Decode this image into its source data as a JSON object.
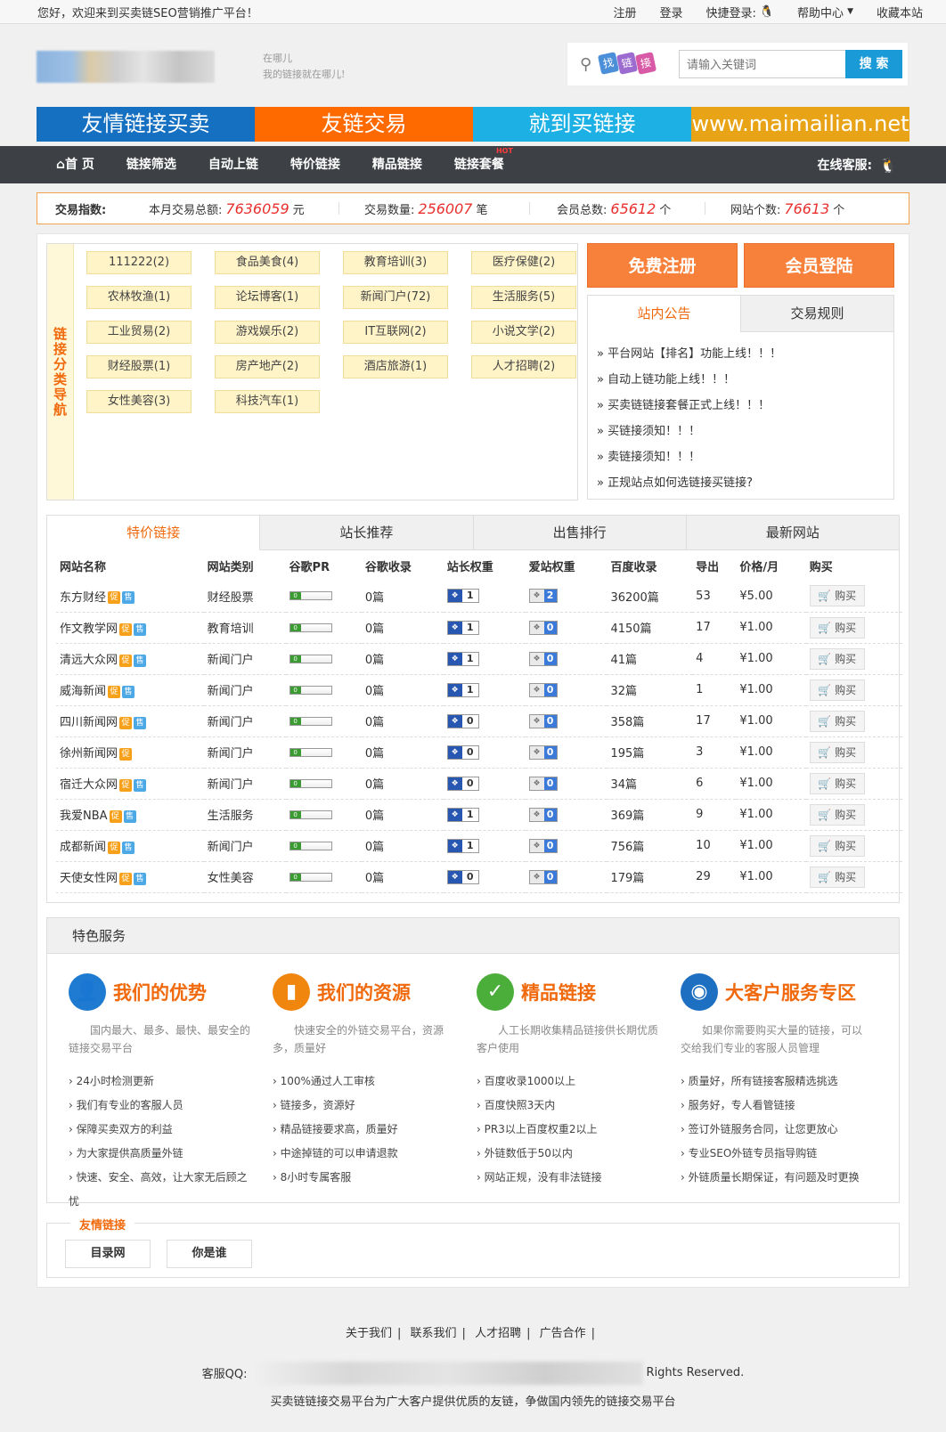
{
  "topbar": {
    "welcome": "您好，欢迎来到买卖链SEO营销推广平台！",
    "register": "注册",
    "login": "登录",
    "quick_login": "快捷登录:",
    "help": "帮助中心",
    "favorite": "收藏本站"
  },
  "header": {
    "slogan_line1": "在哪儿",
    "slogan_line2": "我的链接就在哪儿!",
    "findlink_chars": [
      "找",
      "链",
      "接"
    ],
    "search_placeholder": "请输入关键词",
    "search_button": "搜 索"
  },
  "banner": [
    {
      "text": "友情链接买卖",
      "color": "#1670c2"
    },
    {
      "text": "友链交易",
      "color": "#ff6a00"
    },
    {
      "text": "就到买链接",
      "color": "#1cb0e4"
    },
    {
      "text": "www.maimailian.net",
      "color": "#e8a317"
    }
  ],
  "nav": {
    "items": [
      "首 页",
      "链接筛选",
      "自动上链",
      "特价链接",
      "精品链接",
      "链接套餐"
    ],
    "hot": "HOT",
    "online": "在线客服:"
  },
  "stats": {
    "label": "交易指数:",
    "items": [
      {
        "label": "本月交易总额:",
        "value": "7636059",
        "unit": "元"
      },
      {
        "label": "交易数量:",
        "value": "256007",
        "unit": "笔"
      },
      {
        "label": "会员总数:",
        "value": "65612",
        "unit": "个"
      },
      {
        "label": "网站个数:",
        "value": "76613",
        "unit": "个"
      }
    ]
  },
  "categories": {
    "side_label": "链接分类导航",
    "items": [
      "111222(2)",
      "食品美食(4)",
      "教育培训(3)",
      "医疗保健(2)",
      "农林牧渔(1)",
      "论坛博客(1)",
      "新闻门户(72)",
      "生活服务(5)",
      "工业贸易(2)",
      "游戏娱乐(2)",
      "IT互联网(2)",
      "小说文学(2)",
      "财经股票(1)",
      "房产地产(2)",
      "酒店旅游(1)",
      "人才招聘(2)",
      "女性美容(3)",
      "科技汽车(1)"
    ]
  },
  "actions": {
    "register": "免费注册",
    "login": "会员登陆"
  },
  "notice": {
    "tabs": [
      "站内公告",
      "交易规则"
    ],
    "items": [
      "» 平台网站【排名】功能上线！！！",
      "» 自动上链功能上线！！！",
      "» 买卖链链接套餐正式上线！！！",
      "» 买链接须知！！！",
      "» 卖链接须知！！！",
      "» 正规站点如何选链接买链接?"
    ]
  },
  "listing": {
    "tabs": [
      "特价链接",
      "站长推荐",
      "出售排行",
      "最新网站"
    ],
    "headers": [
      "网站名称",
      "网站类别",
      "谷歌PR",
      "谷歌收录",
      "站长权重",
      "爱站权重",
      "百度收录",
      "导出",
      "价格/月",
      "购买"
    ],
    "pr_label": "0",
    "buy_label": "购买",
    "badge1": "促",
    "badge2": "售",
    "rows": [
      {
        "name": "东方财经",
        "cat": "财经股票",
        "google": "0篇",
        "zz": "1",
        "az": "2",
        "baidu": "36200篇",
        "out": "53",
        "price": "¥5.00",
        "sale": true
      },
      {
        "name": "作文教学网",
        "cat": "教育培训",
        "google": "0篇",
        "zz": "1",
        "az": "0",
        "baidu": "4150篇",
        "out": "17",
        "price": "¥1.00",
        "sale": true
      },
      {
        "name": "清远大众网",
        "cat": "新闻门户",
        "google": "0篇",
        "zz": "1",
        "az": "0",
        "baidu": "41篇",
        "out": "4",
        "price": "¥1.00",
        "sale": true
      },
      {
        "name": "威海新闻",
        "cat": "新闻门户",
        "google": "0篇",
        "zz": "1",
        "az": "0",
        "baidu": "32篇",
        "out": "1",
        "price": "¥1.00",
        "sale": true
      },
      {
        "name": "四川新闻网",
        "cat": "新闻门户",
        "google": "0篇",
        "zz": "0",
        "az": "0",
        "baidu": "358篇",
        "out": "17",
        "price": "¥1.00",
        "sale": true
      },
      {
        "name": "徐州新闻网",
        "cat": "新闻门户",
        "google": "0篇",
        "zz": "0",
        "az": "0",
        "baidu": "195篇",
        "out": "3",
        "price": "¥1.00",
        "sale": false
      },
      {
        "name": "宿迁大众网",
        "cat": "新闻门户",
        "google": "0篇",
        "zz": "0",
        "az": "0",
        "baidu": "34篇",
        "out": "6",
        "price": "¥1.00",
        "sale": true
      },
      {
        "name": "我爱NBA",
        "cat": "生活服务",
        "google": "0篇",
        "zz": "1",
        "az": "0",
        "baidu": "369篇",
        "out": "9",
        "price": "¥1.00",
        "sale": true
      },
      {
        "name": "成都新闻",
        "cat": "新闻门户",
        "google": "0篇",
        "zz": "1",
        "az": "0",
        "baidu": "756篇",
        "out": "10",
        "price": "¥1.00",
        "sale": true
      },
      {
        "name": "天使女性网",
        "cat": "女性美容",
        "google": "0篇",
        "zz": "0",
        "az": "0",
        "baidu": "179篇",
        "out": "29",
        "price": "¥1.00",
        "sale": true
      }
    ]
  },
  "services": {
    "title": "特色服务",
    "cols": [
      {
        "title": "我们的优势",
        "icon": "user-icon",
        "color": "#1f7bd1",
        "desc": "国内最大、最多、最快、最安全的链接交易平台",
        "items": [
          "24小时检测更新",
          "我们有专业的客服人员",
          "保障买卖双方的利益",
          "为大家提供高质量外链",
          "快速、安全、高效，让大家无后顾之忧"
        ]
      },
      {
        "title": "我们的资源",
        "icon": "bar-chart-icon",
        "color": "#f0860e",
        "desc": "快速安全的外链交易平台，资源多，质量好",
        "items": [
          "100%通过人工审核",
          "链接多，资源好",
          "精品链接要求高，质量好",
          "中途掉链的可以申请退款",
          "8小时专属客服"
        ]
      },
      {
        "title": "精品链接",
        "icon": "check-icon",
        "color": "#4cae3a",
        "desc": "人工长期收集精品链接供长期优质客户使用",
        "items": [
          "百度收录1000以上",
          "百度快照3天内",
          "PR3以上百度权重2以上",
          "外链数低于50以内",
          "网站正规，没有非法链接"
        ]
      },
      {
        "title": "大客户服务专区",
        "icon": "globe-icon",
        "color": "#1c6fc1",
        "desc": "如果你需要购买大量的链接，可以交给我们专业的客服人员管理",
        "items": [
          "质量好，所有链接客服精选挑选",
          "服务好，专人看管链接",
          "签订外链服务合同，让您更放心",
          "专业SEO外链专员指导购链",
          "外链质量长期保证，有问题及时更换"
        ]
      }
    ]
  },
  "friends": {
    "title": "友情链接",
    "links": [
      "目录网",
      "你是谁"
    ]
  },
  "footer": {
    "links": [
      "关于我们",
      "联系我们",
      "人才招聘",
      "广告合作"
    ],
    "qq_label": "客服QQ:",
    "rights": "Rights Reserved.",
    "bottom": "买卖链链接交易平台为广大客户提供优质的友链，争做国内领先的链接交易平台"
  }
}
